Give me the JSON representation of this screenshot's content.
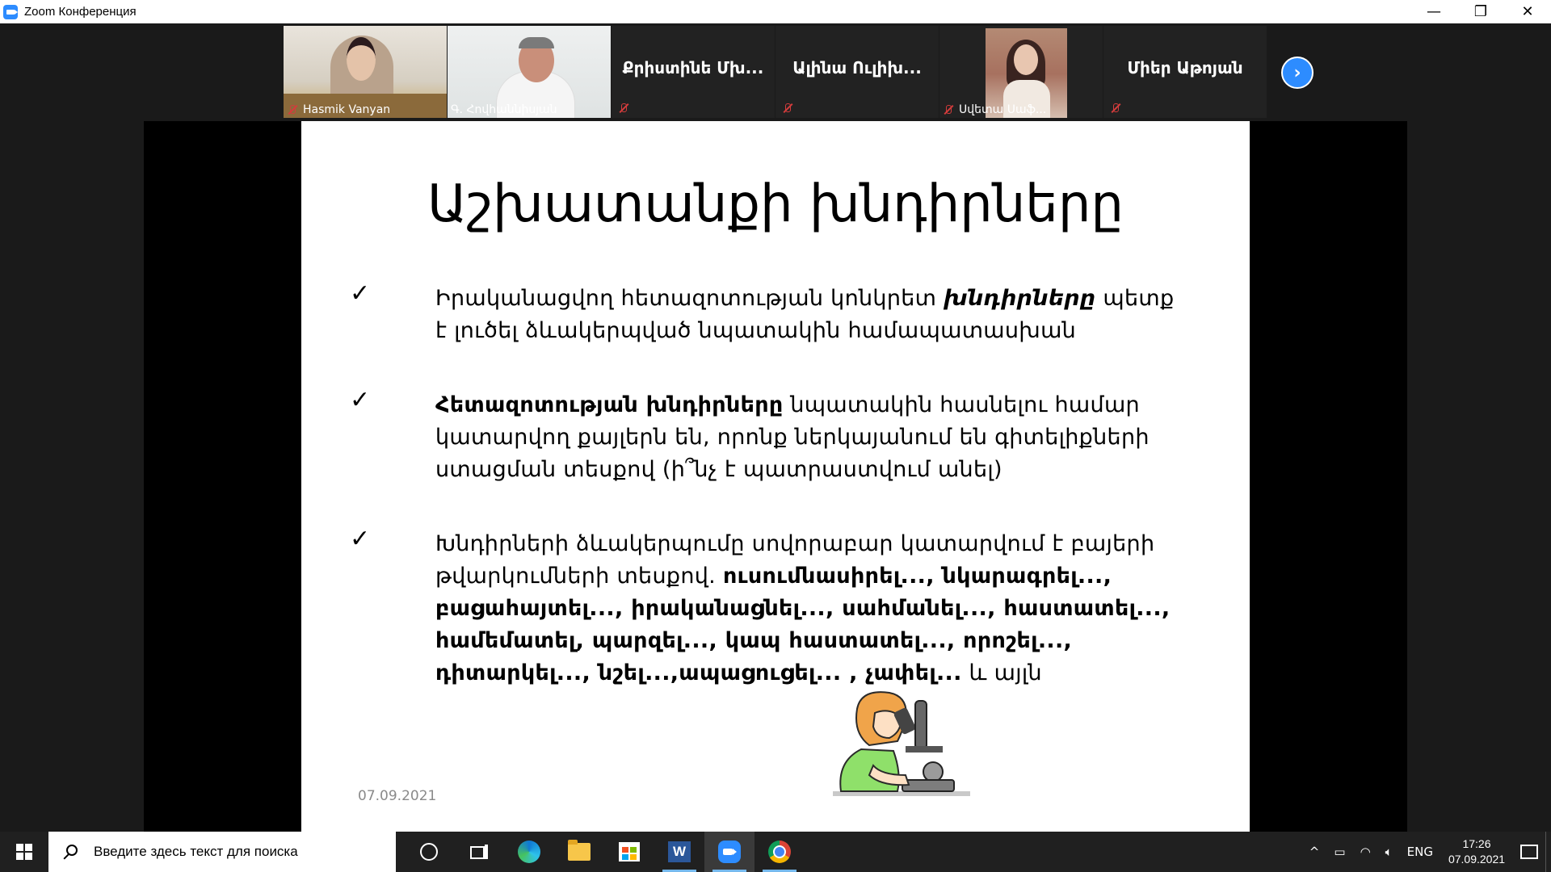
{
  "window": {
    "title": "Zoom Конференция",
    "minimize": "—",
    "maximize": "❐",
    "close": "✕"
  },
  "participants": [
    {
      "name": "Hasmik Vanyan",
      "muted": true,
      "video": true
    },
    {
      "name": "Գ. Հովհաննիսյան",
      "muted": false,
      "video": true,
      "active": true
    },
    {
      "name": "Քրիստինե Մխ...",
      "muted": true,
      "video": false
    },
    {
      "name": "Ալինա Ուլիխ...",
      "muted": true,
      "video": false
    },
    {
      "name": "Սվետա Սաֆ...",
      "muted": true,
      "video": true
    },
    {
      "name": "Միեր Աթոյան",
      "muted": true,
      "video": false
    }
  ],
  "next_label": "›",
  "slide": {
    "title": "Աշխատանքի խնդիրները",
    "bullet1": {
      "pre": "Իրականացվող հետազոտության կոնկրետ ",
      "bold_italic": "խնդիրները",
      "post": " պետք է լուծել ձևակերպված նպատակին համապատասխան"
    },
    "bullet2": {
      "bold": "Հետազոտության խնդիրները",
      "post": " նպատակին հասնելու համար կատարվող քայլերն են, որոնք ներկայանում են գիտելիքների ստացման տեսքով (ի՞նչ է պատրաստվում անել)"
    },
    "bullet3": {
      "pre": " Խնդիրների ձևակերպումը սովորաբար կատարվում է բայերի թվարկումների տեսքով.    ",
      "bold": "ուսումնասիրել..., նկարագրել..., բացահայտել..., իրականացնել..., սահմանել..., հաստատել..., համեմատել, պարզել..., կապ հաստատել..., որոշել..., դիտարկել..., նշել...,ապացուցել... , չափել...",
      "post": " և այլն"
    },
    "check": "✓",
    "date": "07.09.2021"
  },
  "taskbar": {
    "search_placeholder": "Введите здесь текст для поиска",
    "word_letter": "W",
    "tray_chevron": "^",
    "language": "ENG",
    "time": "17:26",
    "date": "07.09.2021"
  }
}
